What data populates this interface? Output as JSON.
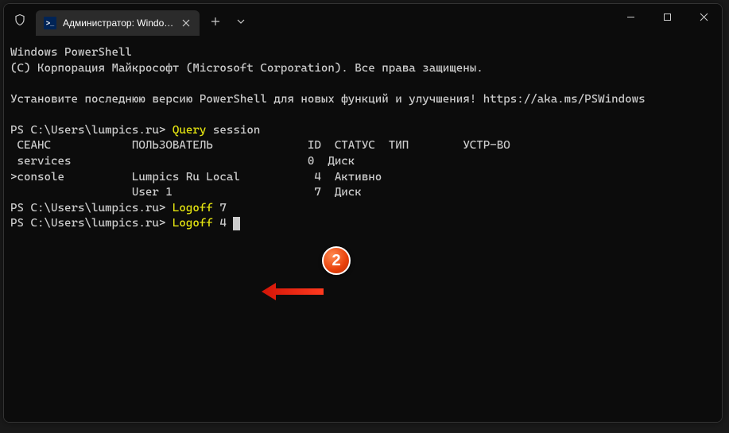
{
  "titlebar": {
    "tab_title": "Администратор: Windows Po",
    "tab_icon_text": ">_"
  },
  "terminal": {
    "line1": "Windows PowerShell",
    "line2": "(C) Корпорация Майкрософт (Microsoft Corporation). Все права защищены.",
    "line3": "",
    "line4": "Установите последнюю версию PowerShell для новых функций и улучшения! https://aka.ms/PSWindows",
    "line5": "",
    "prompt1": "PS C:\\Users\\lumpics.ru> ",
    "cmd1_a": "Query",
    "cmd1_b": " session",
    "header": " СЕАНС            ПОЛЬЗОВАТЕЛЬ              ID  СТАТУС  ТИП        УСТР-ВО",
    "row1": " services                                   0  Диск",
    "row2": ">console          Lumpics Ru Local           4  Активно",
    "row3": "                  User 1                     7  Диск",
    "prompt2": "PS C:\\Users\\lumpics.ru> ",
    "cmd2_a": "Logoff",
    "cmd2_b": " 7",
    "prompt3": "PS C:\\Users\\lumpics.ru> ",
    "cmd3_a": "Logoff",
    "cmd3_b": " 4"
  },
  "annotation": {
    "badge_number": "2"
  }
}
